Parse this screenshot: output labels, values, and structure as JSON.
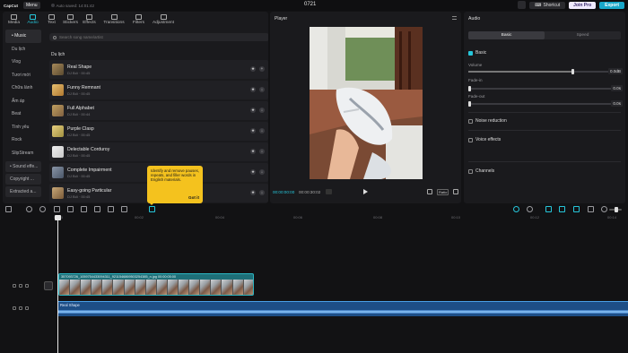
{
  "titlebar": {
    "logo": "CapCut",
    "menu_label": "Menu",
    "autosave": "Auto saved: 14:01:42",
    "project_title": "0721",
    "shortcut_label": "Shortcut",
    "joinpro_label": "Join Pro",
    "export_label": "Export"
  },
  "tool_tabs": [
    {
      "label": "Media",
      "icon": "media-icon"
    },
    {
      "label": "Audio",
      "icon": "audio-icon"
    },
    {
      "label": "Text",
      "icon": "text-icon"
    },
    {
      "label": "Stickers",
      "icon": "stickers-icon"
    },
    {
      "label": "Effects",
      "icon": "effects-icon"
    },
    {
      "label": "Transitions",
      "icon": "transitions-icon"
    },
    {
      "label": "Filters",
      "icon": "filters-icon"
    },
    {
      "label": "Adjustment",
      "icon": "adjustment-icon"
    }
  ],
  "categories": {
    "music": "• Music",
    "items": [
      "Du lịch",
      "Vlog",
      "Tươi mới",
      "Chữa lành",
      "Ấm áp",
      "Beat",
      "Tình yêu",
      "Rock",
      "SlipStream"
    ],
    "sound_effects": "• Sound effe...",
    "copyright": "Copyright ...",
    "extracted": "Extracted a..."
  },
  "search": {
    "placeholder": "Search song name/artist"
  },
  "section_label": "Du lịch",
  "tracks": [
    {
      "name": "Real Shape",
      "meta": "DJ Bối · 00:45"
    },
    {
      "name": "Funny Remnant",
      "meta": "DJ Bối · 00:45"
    },
    {
      "name": "Full Alphabet",
      "meta": "DJ Bối · 00:44"
    },
    {
      "name": "Purple Clasp",
      "meta": "DJ Bối · 00:45"
    },
    {
      "name": "Delectable Corduroy",
      "meta": "DJ Bối · 00:45"
    },
    {
      "name": "Complete Impairment",
      "meta": "DJ Bối · 00:45"
    },
    {
      "name": "Easy-going Particular",
      "meta": "DJ Bối · 00:45"
    }
  ],
  "tooltip": {
    "text": "Identify and remove pauses, repeats, and filler words in English materials.",
    "action": "Got it"
  },
  "player": {
    "title": "Player",
    "current_time": "00:00:00:00",
    "duration": "00:00:30:02",
    "ratio_label": "Ratio"
  },
  "audio_panel": {
    "title": "Audio",
    "tabs": [
      "Basic",
      "Speed"
    ],
    "basic_label": "Basic",
    "volume_label": "Volume",
    "volume_value": "0.0dB",
    "fadein_label": "Fade-in",
    "fadein_value": "0.0s",
    "fadeout_label": "Fade-out",
    "fadeout_value": "0.0s",
    "noise_label": "Noise reduction",
    "voice_label": "Voice effects",
    "channels_label": "Channels"
  },
  "ruler_labels": [
    "00:00",
    "00:02",
    "00:04",
    "00:06",
    "00:08",
    "00:10",
    "00:12",
    "00:14"
  ],
  "timeline": {
    "video_clip_name": "357093726_1059754433094311_9211546869503254385_n.jpg  00:00:05:00",
    "audio_clip_name": "Real Shape"
  },
  "colors": {
    "accent": "#26c6da",
    "export": "#19a7c9",
    "tooltip": "#f4c21e",
    "video_clip": "#1e6f78",
    "audio_clip": "#1d4e86"
  }
}
